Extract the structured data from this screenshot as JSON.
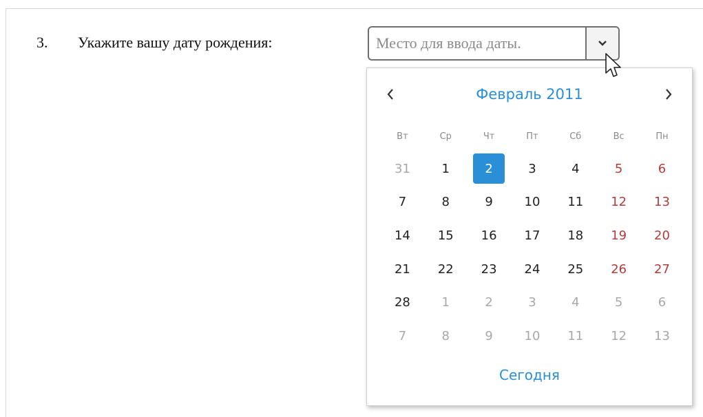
{
  "question": {
    "number": "3.",
    "text": "Укажите вашу дату рождения:"
  },
  "date_field": {
    "placeholder": "Место для ввода даты.",
    "value": "",
    "dropdown_icon": "chevron-down-icon"
  },
  "calendar": {
    "month_title": "Февраль 2011",
    "prev_icon": "chevron-left-icon",
    "next_icon": "chevron-right-icon",
    "weekdays": [
      "Вт",
      "Ср",
      "Чт",
      "Пт",
      "Сб",
      "Вс",
      "Пн"
    ],
    "weeks": [
      [
        "31",
        "1",
        "2",
        "3",
        "4",
        "5",
        "6"
      ],
      [
        "7",
        "8",
        "9",
        "10",
        "11",
        "12",
        "13"
      ],
      [
        "14",
        "15",
        "16",
        "17",
        "18",
        "19",
        "20"
      ],
      [
        "21",
        "22",
        "23",
        "24",
        "25",
        "26",
        "27"
      ],
      [
        "28",
        "1",
        "2",
        "3",
        "4",
        "5",
        "6"
      ],
      [
        "7",
        "8",
        "9",
        "10",
        "11",
        "12",
        "13"
      ]
    ],
    "selected_day": "2",
    "today_label": "Сегодня"
  },
  "colors": {
    "accent": "#2a8fd6",
    "weekend": "#b23c3c",
    "other_month": "#a8a8a8"
  }
}
